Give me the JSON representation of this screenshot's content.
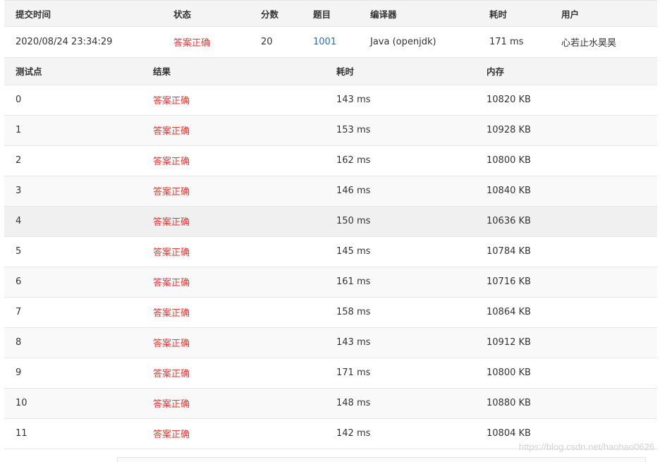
{
  "summary": {
    "headers": {
      "time": "提交时间",
      "status": "状态",
      "score": "分数",
      "problem": "题目",
      "compiler": "编译器",
      "duration": "耗时",
      "user": "用户"
    },
    "row": {
      "time": "2020/08/24 23:34:29",
      "status": "答案正确",
      "score": "20",
      "problem": "1001",
      "compiler": "Java (openjdk)",
      "duration": "171 ms",
      "user": "心若止水昊昊"
    }
  },
  "cases": {
    "headers": {
      "point": "测试点",
      "result": "结果",
      "duration": "耗时",
      "memory": "内存"
    },
    "rows": [
      {
        "point": "0",
        "result": "答案正确",
        "duration": "143 ms",
        "memory": "10820 KB"
      },
      {
        "point": "1",
        "result": "答案正确",
        "duration": "153 ms",
        "memory": "10928 KB"
      },
      {
        "point": "2",
        "result": "答案正确",
        "duration": "162 ms",
        "memory": "10800 KB"
      },
      {
        "point": "3",
        "result": "答案正确",
        "duration": "146 ms",
        "memory": "10840 KB"
      },
      {
        "point": "4",
        "result": "答案正确",
        "duration": "150 ms",
        "memory": "10636 KB"
      },
      {
        "point": "5",
        "result": "答案正确",
        "duration": "145 ms",
        "memory": "10784 KB"
      },
      {
        "point": "6",
        "result": "答案正确",
        "duration": "161 ms",
        "memory": "10716 KB"
      },
      {
        "point": "7",
        "result": "答案正确",
        "duration": "158 ms",
        "memory": "10864 KB"
      },
      {
        "point": "8",
        "result": "答案正确",
        "duration": "143 ms",
        "memory": "10912 KB"
      },
      {
        "point": "9",
        "result": "答案正确",
        "duration": "171 ms",
        "memory": "10800 KB"
      },
      {
        "point": "10",
        "result": "答案正确",
        "duration": "148 ms",
        "memory": "10880 KB"
      },
      {
        "point": "11",
        "result": "答案正确",
        "duration": "142 ms",
        "memory": "10804 KB"
      }
    ]
  },
  "watermark": "https://blog.csdn.net/haohao0626",
  "colors": {
    "accepted": "#e53935",
    "link": "#2a6fb0",
    "header_bg": "#f4f4f4"
  }
}
